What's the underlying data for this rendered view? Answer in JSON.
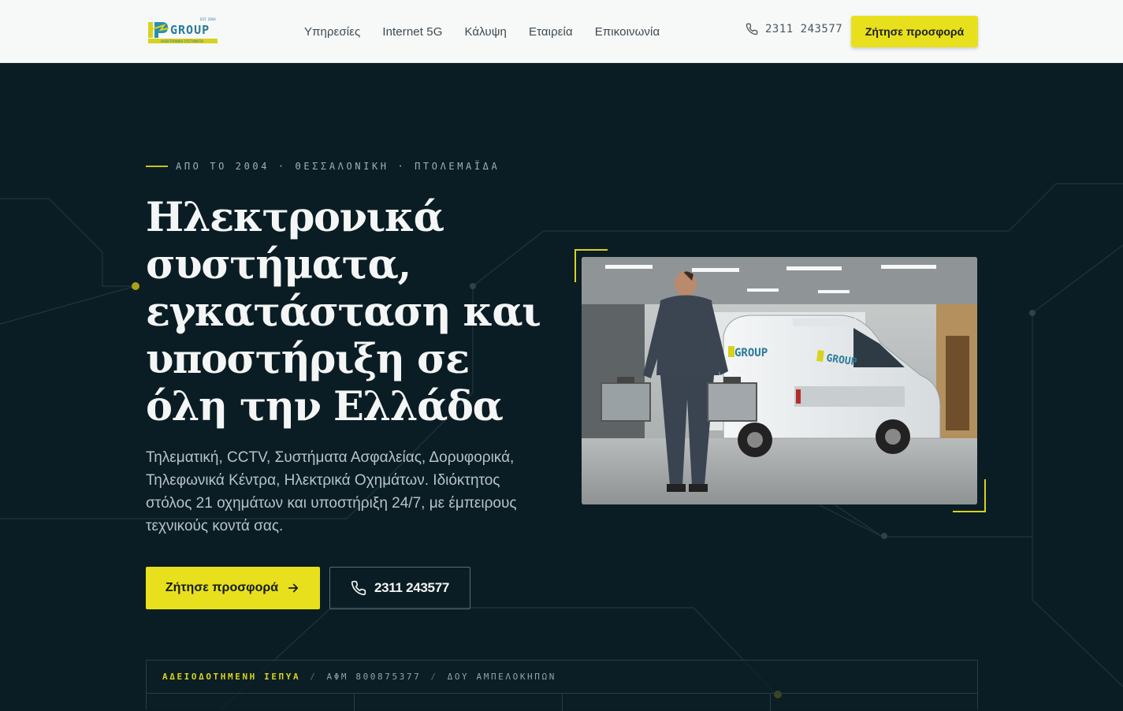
{
  "brand": {
    "logo_text": "GROUP",
    "logo_est": "EST. 2004",
    "logo_tagline": "ΗΛΕΚΤΡΟΝΙΚΑ ΣΥΣΤΗΜΑΤΑ"
  },
  "nav": {
    "items": [
      "Υπηρεσίες",
      "Internet 5G",
      "Κάλυψη",
      "Εταιρεία",
      "Επικοινωνία"
    ]
  },
  "header": {
    "phone": "2311  243577",
    "cta_label": "Ζήτησε προσφορά"
  },
  "hero": {
    "eyebrow": "ΑΠΟ ΤΟ 2004  ·  ΘΕΣΣΑΛΟΝΙΚΗ  ·  ΠΤΟΛΕΜΑΪΔΑ",
    "headline": "Ηλεκτρονικά συστήματα, εγκατάσταση και υποστήριξη σε όλη την Ελλάδα",
    "subtitle": "Τηλεματική, CCTV, Συστήματα Ασφαλείας, Δορυφορικά, Τηλεφωνικά Κέντρα, Ηλεκτρικά Οχημάτων. Ιδιόκτητος στόλος 21 οχημάτων και υποστήριξη 24/7, με έμπειρους τεχνικούς κοντά σας.",
    "primary_cta": "Ζήτησε προσφορά",
    "secondary_cta": "2311 243577",
    "photo_van_text": "GROUP"
  },
  "info_strip": {
    "license": "ΑΔΕΙΟΔΟΤΗΜΕΝΗ ΙΕΠΥΑ",
    "separator": "/",
    "vat": "ΑΦΜ 800875377",
    "tax_office": "ΔΟΥ ΑΜΠΕΛΟΚΗΠΩΝ"
  },
  "colors": {
    "accent": "#e8e01c",
    "background": "#0b1d24",
    "header_bg": "#f7f8f8"
  }
}
